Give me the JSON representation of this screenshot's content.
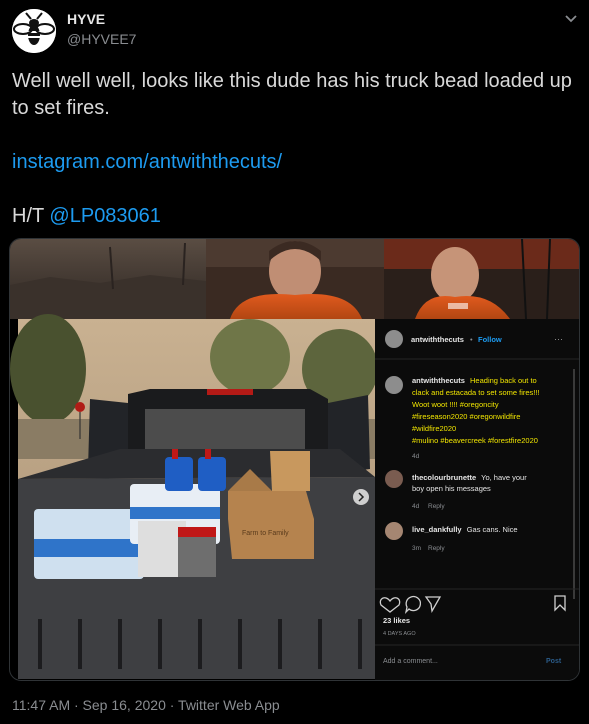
{
  "author": {
    "display_name": "HYVE",
    "handle": "@HYVEE7"
  },
  "tweet": {
    "line1": "Well well well, looks like this dude has his truck bead loaded up to set fires.",
    "link": "instagram.com/antwiththecuts/",
    "ht_prefix": "H/T ",
    "ht_mention": "@LP083061"
  },
  "instagram": {
    "username": "antwiththecuts",
    "follow": "Follow",
    "caption_user": "antwiththecuts",
    "caption_lines": [
      "Heading back out to",
      "clack and estacada to set some fires!!!",
      "Woot woot !!!! #oregoncity",
      "#fireseason2020 #oregonwildfire",
      "#wildfire2020",
      "#mulino #beavercreek #forestfire2020"
    ],
    "caption_age": "4d",
    "comments": [
      {
        "user": "thecolourbrunette",
        "text_lines": [
          "Yo, have your",
          "boy open his messages"
        ],
        "age": "4d",
        "reply": "Reply"
      },
      {
        "user": "live_dankfully",
        "text_lines": [
          "Gas cans. Nice"
        ],
        "age": "3m",
        "reply": "Reply"
      }
    ],
    "likes": "23 likes",
    "posted": "4 DAYS AGO",
    "add_comment_placeholder": "Add a comment...",
    "post_button": "Post",
    "box_label": "Farm to Family"
  },
  "meta": {
    "timestamp": "11:47 AM · Sep 16, 2020 · Twitter Web App"
  },
  "colors": {
    "link": "#1d9bf0",
    "background": "#000000",
    "ig_caption_yellow": "#f2e600"
  },
  "icons": [
    "bee-avatar-icon",
    "chevron-down-icon",
    "more-dots-icon",
    "heart-icon",
    "comment-icon",
    "share-icon",
    "bookmark-icon",
    "next-arrow-icon"
  ]
}
